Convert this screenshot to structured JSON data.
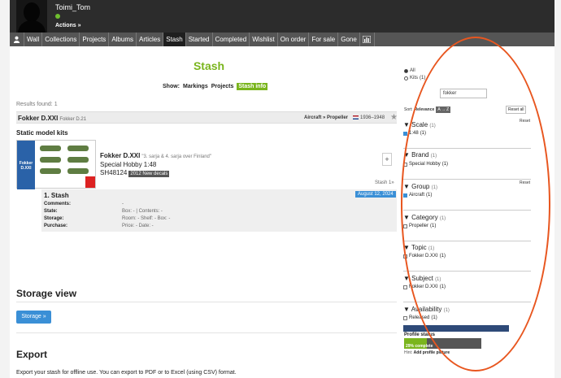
{
  "user": {
    "name": "Toimi_Tom",
    "actions": "Actions »"
  },
  "nav": [
    "Wall",
    "Collections",
    "Projects",
    "Albums",
    "Articles",
    "Stash",
    "Started",
    "Completed",
    "Wishlist",
    "On order",
    "For sale",
    "Gone"
  ],
  "nav_active": "Stash",
  "page": {
    "title": "Stash",
    "show_label": "Show:",
    "show_buttons": [
      "Markings",
      "Projects",
      "Stash info"
    ],
    "results": "Results found: 1"
  },
  "item": {
    "name": "Fokker D.XXI",
    "subname": "Fokker D.21",
    "category": "Aircraft » Propeller",
    "years": "1936–1948",
    "section": "Static model kits",
    "box_text": "Fokker D.XXI",
    "kit_name": "Fokker D.XXI",
    "kit_quote": "\"3. sarja & 4. sarja over Finland\"",
    "maker": "Special Hobby 1:48",
    "code": "SH48124",
    "tag": "2012 New decals",
    "plus": "+",
    "stash_count": "Stash 1»",
    "stash": {
      "heading": "1. Stash",
      "date": "August 12, 2024",
      "rows": [
        {
          "label": "Comments:",
          "value": "-"
        },
        {
          "label": "State:",
          "value": "Box: - | Contents: -"
        },
        {
          "label": "Storage:",
          "value": "Room: - Shelf: - Box: -"
        },
        {
          "label": "Purchase:",
          "value": "Price: - Date: -"
        }
      ]
    }
  },
  "storage": {
    "heading": "Storage view",
    "button": "Storage »"
  },
  "export": {
    "heading": "Export",
    "text": "Export your stash for offline use. You can export to PDF or to Excel (using CSV) format."
  },
  "filters": {
    "radio_all": "All",
    "radio_kits": "Kits",
    "radio_kits_count": "(1)",
    "search_value": "fokker",
    "sort_label": "Sort:",
    "sort_relevance": "Relevance",
    "sort_az": "A → Z",
    "reset_all": "Reset all",
    "reset": "Reset",
    "groups": [
      {
        "name": "Scale",
        "count": "(1)",
        "option": "1:48",
        "option_count": "(1)",
        "checked": true,
        "reset": true
      },
      {
        "name": "Brand",
        "count": "(1)",
        "option": "Special Hobby",
        "option_count": "(1)",
        "checked": false,
        "reset": false
      },
      {
        "name": "Group",
        "count": "(1)",
        "option": "Aircraft",
        "option_count": "(1)",
        "checked": true,
        "reset": true
      },
      {
        "name": "Category",
        "count": "(1)",
        "option": "Propeller",
        "option_count": "(1)",
        "checked": false,
        "reset": false
      },
      {
        "name": "Topic",
        "count": "(1)",
        "option": "Fokker D.XXI",
        "option_count": "(1)",
        "checked": false,
        "reset": false
      },
      {
        "name": "Subject",
        "count": "(1)",
        "option": "Fokker D.XXI",
        "option_count": "(1)",
        "checked": false,
        "reset": false
      },
      {
        "name": "Availability",
        "count": "(1)",
        "option": "Released",
        "option_count": "(1)",
        "checked": false,
        "reset": false
      }
    ]
  },
  "profile_status": {
    "heading": "Profile status",
    "percent_text": "29% complete",
    "progress": 0.29,
    "hint_label": "Hint:",
    "hint_link": "Add profile picture"
  },
  "colors": {
    "accent_green": "#7ab51d",
    "accent_blue": "#3a8fd6",
    "annotation_orange": "#e8561f"
  }
}
